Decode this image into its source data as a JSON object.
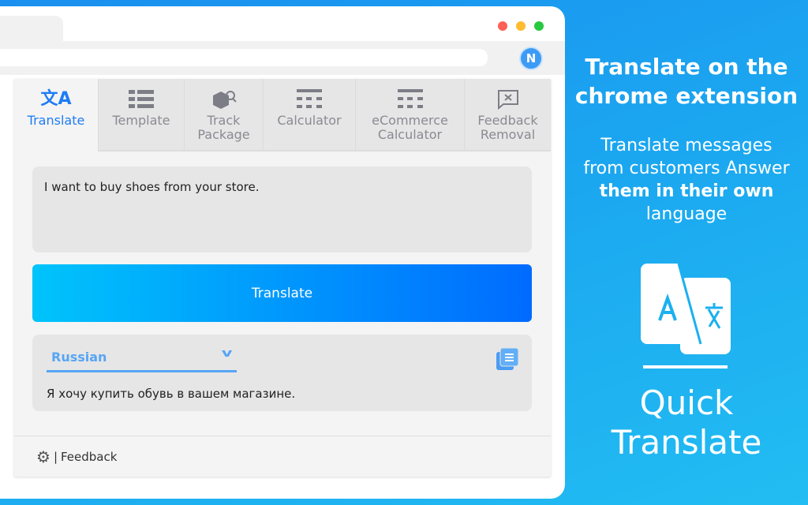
{
  "browser": {
    "avatar_letter": "N",
    "dots": [
      "#fe5f57",
      "#febc2e",
      "#28c840"
    ]
  },
  "extension": {
    "tabs": [
      {
        "label": "Translate",
        "icon": "translate-icon"
      },
      {
        "label": "Template",
        "icon": "list-icon"
      },
      {
        "label": "Track\nPackage",
        "icon": "package-search-icon"
      },
      {
        "label": "Calculator",
        "icon": "calculator-icon"
      },
      {
        "label": "eCommerce\nCalculator",
        "icon": "calculator-icon"
      },
      {
        "label": "Feedback\nRemoval",
        "icon": "feedback-remove-icon"
      }
    ],
    "input_text": "I want to buy shoes from your store.",
    "translate_button": "Translate",
    "language": "Russian",
    "output_text": "Я хочу купить обувь в вашем магазине.",
    "footer": {
      "separator": "|",
      "feedback": "Feedback"
    }
  },
  "promo": {
    "title_line1": "Translate on the",
    "title_line2": "chrome extension",
    "sub1": "Translate messages",
    "sub2": "from customers Answer",
    "sub3_bold": "them in their own",
    "sub4": "language",
    "brand1": "Quick",
    "brand2": "Translate"
  },
  "colors": {
    "accent": "#1e7cf5",
    "button_start": "#00c4fb",
    "button_end": "#006bff"
  }
}
